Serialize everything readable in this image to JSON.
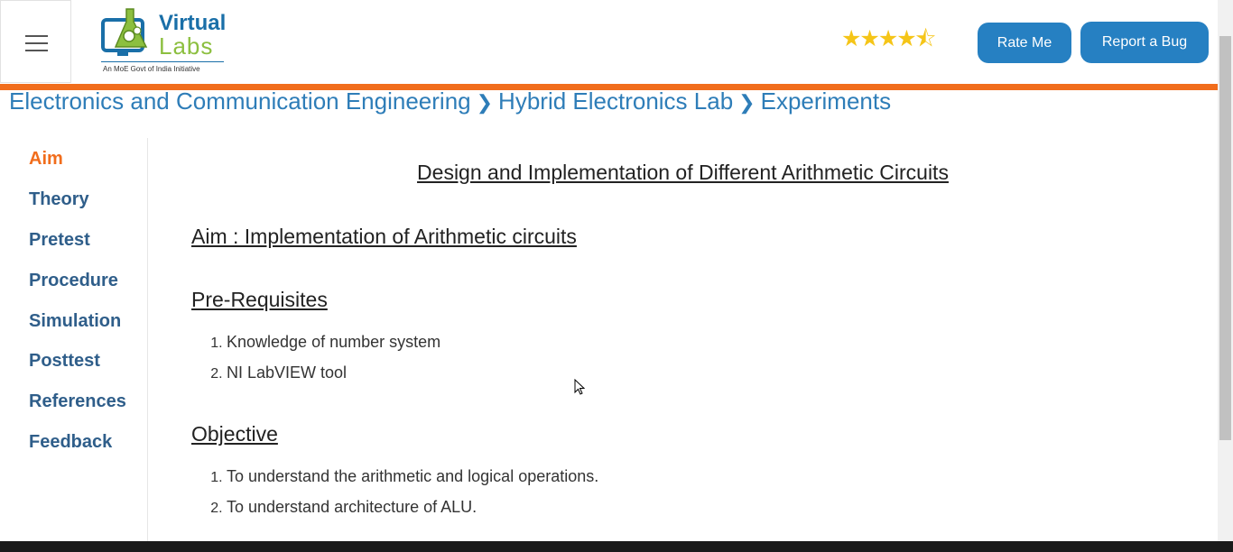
{
  "header": {
    "logo": {
      "word1": "Virtual",
      "word2": "Labs",
      "tagline": "An MoE Govt of India Initiative"
    },
    "rating": {
      "value": 4.5,
      "max": 5,
      "stars_display": "★★★★⯪"
    },
    "rate_button": "Rate Me",
    "bug_button": "Report a Bug"
  },
  "breadcrumb": [
    "Electronics and Communication Engineering",
    "Hybrid Electronics Lab",
    "Experiments"
  ],
  "sidebar": {
    "items": [
      {
        "label": "Aim",
        "active": true
      },
      {
        "label": "Theory"
      },
      {
        "label": "Pretest"
      },
      {
        "label": "Procedure"
      },
      {
        "label": "Simulation"
      },
      {
        "label": "Posttest"
      },
      {
        "label": "References"
      },
      {
        "label": "Feedback"
      }
    ]
  },
  "content": {
    "title": "Design and Implementation of Different Arithmetic Circuits",
    "aim": "Aim : Implementation of Arithmetic circuits",
    "prereq_heading": "Pre-Requisites",
    "prereq_items": [
      "Knowledge of number system",
      "NI LabVIEW tool"
    ],
    "objective_heading": "Objective",
    "objective_items": [
      "To understand the arithmetic and logical operations.",
      "To understand architecture of ALU."
    ]
  },
  "colors": {
    "accent": "#f16d1c",
    "primary": "#2680c2",
    "link": "#2e7db8"
  }
}
